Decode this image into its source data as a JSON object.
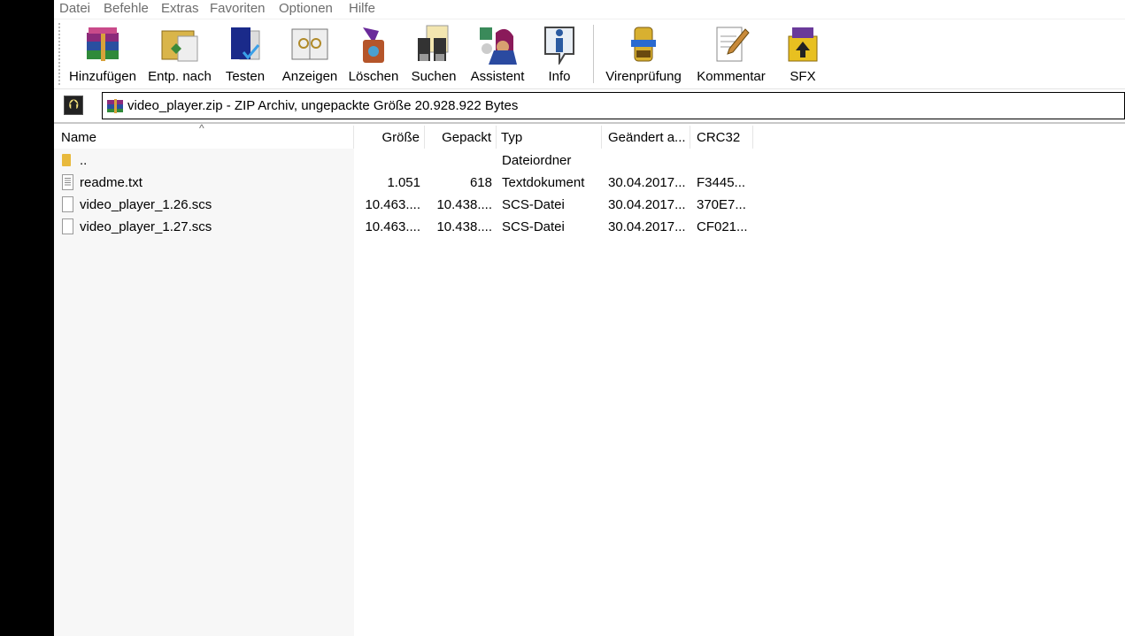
{
  "menu": [
    "Datei",
    "Befehle",
    "Extras",
    "Favoriten",
    "Optionen",
    "Hilfe"
  ],
  "toolbar": [
    {
      "label": "Hinzufügen",
      "icon": "add-archive-icon"
    },
    {
      "label": "Entp. nach",
      "icon": "extract-to-icon"
    },
    {
      "label": "Testen",
      "icon": "test-icon"
    },
    {
      "label": "Anzeigen",
      "icon": "view-icon"
    },
    {
      "label": "Löschen",
      "icon": "delete-icon"
    },
    {
      "label": "Suchen",
      "icon": "find-icon"
    },
    {
      "label": "Assistent",
      "icon": "wizard-icon"
    },
    {
      "label": "Info",
      "icon": "info-icon"
    },
    {
      "label": "Virenprüfung",
      "icon": "virus-scan-icon"
    },
    {
      "label": "Kommentar",
      "icon": "comment-icon"
    },
    {
      "label": "SFX",
      "icon": "sfx-icon"
    }
  ],
  "address": "video_player.zip - ZIP Archiv, ungepackte Größe 20.928.922 Bytes",
  "columns": [
    "Name",
    "Größe",
    "Gepackt",
    "Typ",
    "Geändert a...",
    "CRC32"
  ],
  "rows": [
    {
      "name": "..",
      "size": "",
      "packed": "",
      "type": "Dateiordner",
      "modified": "",
      "crc": "",
      "kind": "folder"
    },
    {
      "name": "readme.txt",
      "size": "1.051",
      "packed": "618",
      "type": "Textdokument",
      "modified": "30.04.2017...",
      "crc": "F3445...",
      "kind": "text"
    },
    {
      "name": "video_player_1.26.scs",
      "size": "10.463....",
      "packed": "10.438....",
      "type": "SCS-Datei",
      "modified": "30.04.2017...",
      "crc": "370E7...",
      "kind": "file"
    },
    {
      "name": "video_player_1.27.scs",
      "size": "10.463....",
      "packed": "10.438....",
      "type": "SCS-Datei",
      "modified": "30.04.2017...",
      "crc": "CF021...",
      "kind": "file"
    }
  ]
}
